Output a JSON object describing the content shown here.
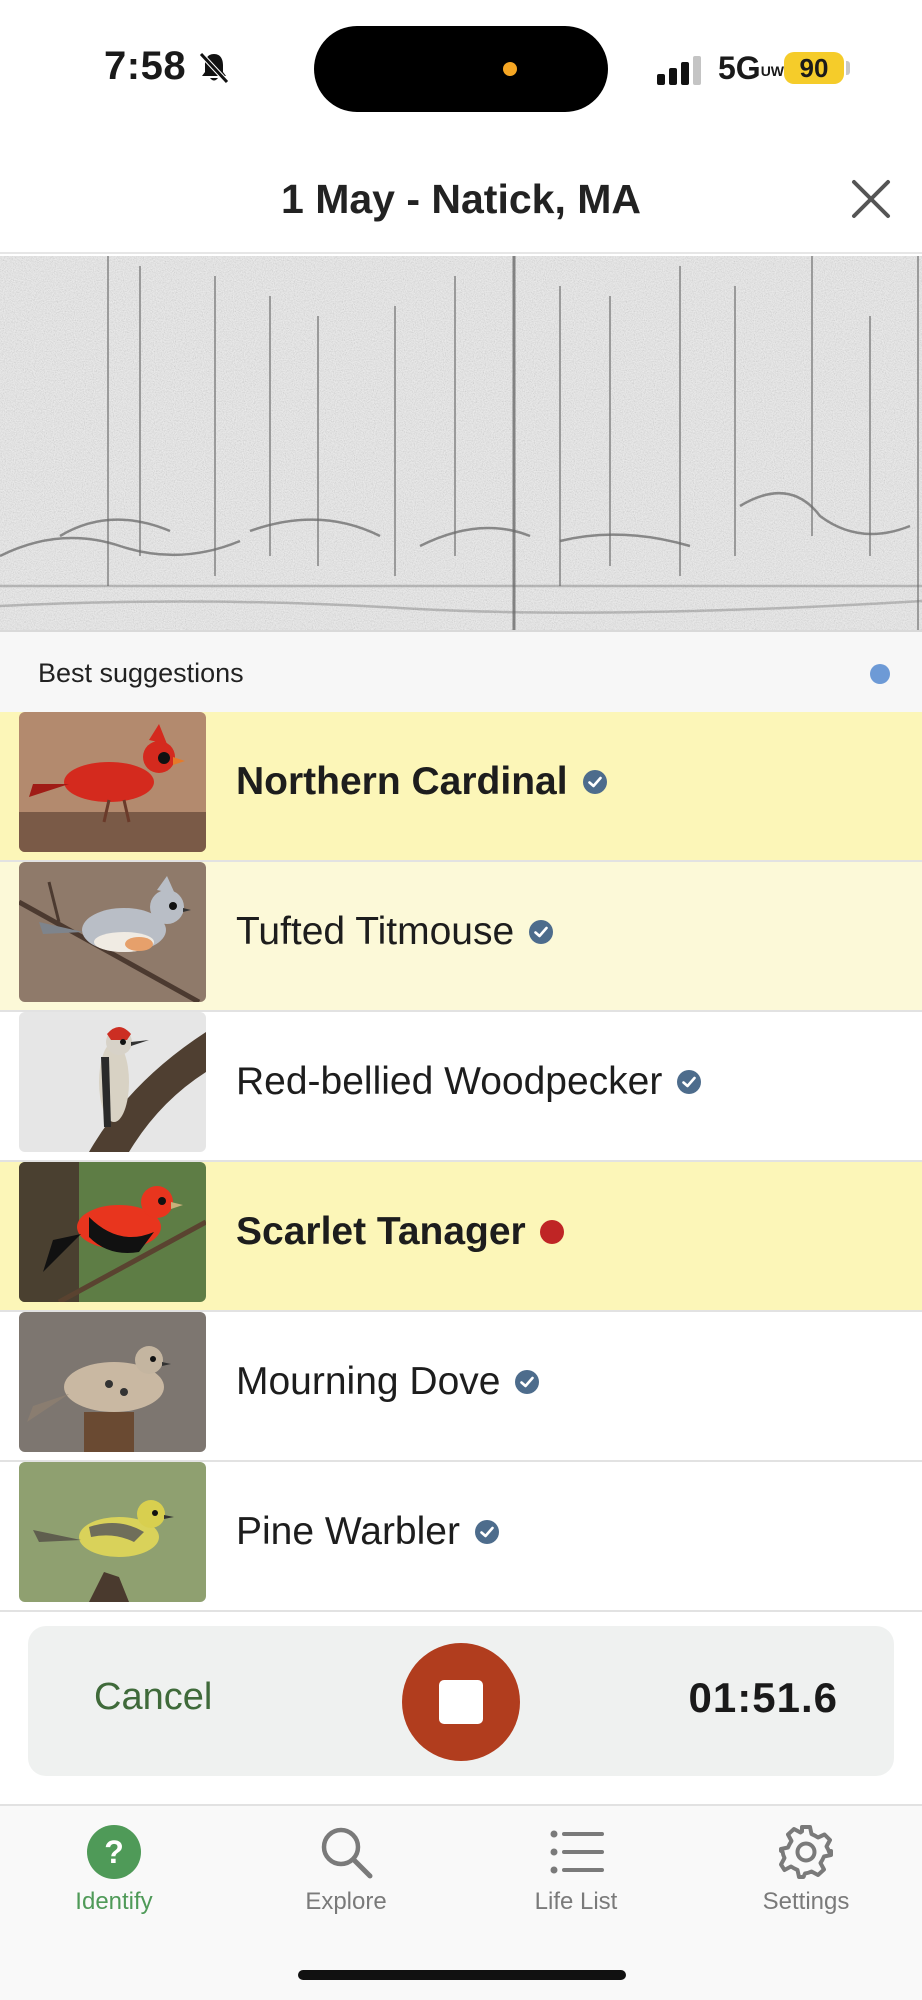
{
  "status_bar": {
    "time": "7:58",
    "network": "5G",
    "network_sup": "UW",
    "battery": "90",
    "icons": [
      "bell-slash-icon",
      "signal-bars-icon",
      "battery-icon"
    ]
  },
  "header": {
    "title": "1 May - Natick, MA",
    "close_icon": "close-icon"
  },
  "spectrogram": {
    "icon": "spectrogram"
  },
  "suggestions": {
    "title": "Best suggestions",
    "indicator_color": "#6d9ad6",
    "items": [
      {
        "name": "Northern Cardinal",
        "marker": "verified",
        "highlight": "#fcf6b8",
        "bold": true,
        "image": "northern-cardinal-photo"
      },
      {
        "name": "Tufted Titmouse",
        "marker": "verified",
        "highlight": "#fcf9d8",
        "bold": false,
        "image": "tufted-titmouse-photo"
      },
      {
        "name": "Red-bellied Woodpecker",
        "marker": "verified",
        "highlight": "#ffffff",
        "bold": false,
        "image": "red-bellied-woodpecker-photo"
      },
      {
        "name": "Scarlet Tanager",
        "marker": "new",
        "highlight": "#fcf6b8",
        "bold": true,
        "image": "scarlet-tanager-photo"
      },
      {
        "name": "Mourning Dove",
        "marker": "verified",
        "highlight": "#ffffff",
        "bold": false,
        "image": "mourning-dove-photo"
      },
      {
        "name": "Pine Warbler",
        "marker": "verified",
        "highlight": "#ffffff",
        "bold": false,
        "image": "pine-warbler-photo"
      }
    ]
  },
  "recording": {
    "cancel_label": "Cancel",
    "timer": "01:51.6",
    "stop_color": "#b13d1e"
  },
  "tabs": [
    {
      "label": "Identify",
      "icon": "question-circle-icon",
      "active": true
    },
    {
      "label": "Explore",
      "icon": "search-icon",
      "active": false
    },
    {
      "label": "Life List",
      "icon": "list-icon",
      "active": false
    },
    {
      "label": "Settings",
      "icon": "gear-icon",
      "active": false
    }
  ],
  "colors": {
    "accent_green": "#4f9a58",
    "verified_badge": "#4d6c8c",
    "new_dot": "#bf2525"
  }
}
